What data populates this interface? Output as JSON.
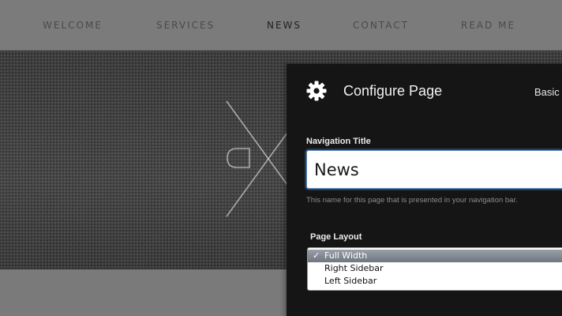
{
  "nav": {
    "items": [
      {
        "label": "WELCOME",
        "active": false
      },
      {
        "label": "SERVICES",
        "active": false
      },
      {
        "label": "NEWS",
        "active": true
      },
      {
        "label": "CONTACT",
        "active": false
      },
      {
        "label": "READ ME",
        "active": false
      }
    ]
  },
  "hero": {
    "logo_icon": "monogram-x-logo"
  },
  "panel": {
    "icon": "gear-icon",
    "title": "Configure Page",
    "tab_label": "Basic",
    "nav_title_label": "Navigation Title",
    "nav_title_value": "News",
    "help_text": "This name for this page that is presented in your navigation bar.",
    "layout_label": "Page Layout",
    "layout_options": [
      {
        "label": "Full Width",
        "selected": true
      },
      {
        "label": "Right Sidebar",
        "selected": false
      },
      {
        "label": "Left Sidebar",
        "selected": false
      }
    ],
    "check_glyph": "✓"
  },
  "colors": {
    "panel_bg": "#151515",
    "nav_bg": "#7b7b7b",
    "input_focus": "#5a8fc7"
  }
}
